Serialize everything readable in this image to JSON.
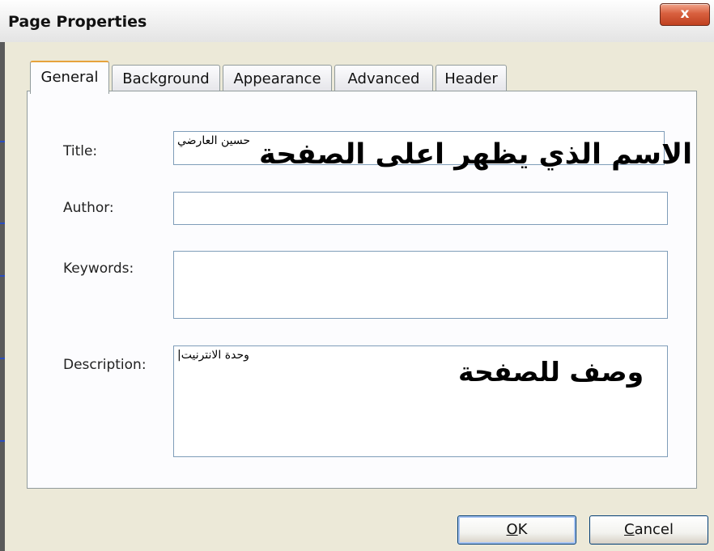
{
  "window": {
    "title": "Page Properties",
    "close_label": "x"
  },
  "tabs": [
    {
      "label": "General"
    },
    {
      "label": "Background"
    },
    {
      "label": "Appearance"
    },
    {
      "label": "Advanced"
    },
    {
      "label": "Header"
    }
  ],
  "active_tab": "General",
  "form": {
    "title_label": "Title:",
    "title_value": "حسين العارضي",
    "author_label": "Author:",
    "author_value": "",
    "keywords_label": "Keywords:",
    "keywords_value": "",
    "description_label": "Description:",
    "description_value": "وحدة الانترنيت|"
  },
  "annotations": {
    "title_note": "الاسم الذي يظهر اعلى الصفحة",
    "description_note": "وصف للصفحة"
  },
  "buttons": {
    "ok_mnemonic": "O",
    "ok_rest": "K",
    "cancel_mnemonic": "C",
    "cancel_rest": "ancel"
  },
  "colors": {
    "dialog_bg": "#ece9d8",
    "panel_bg": "#fcfcfe",
    "close_button": "#d8603f",
    "active_tab_accent": "#e6a23c",
    "field_border": "#7f9db9"
  }
}
